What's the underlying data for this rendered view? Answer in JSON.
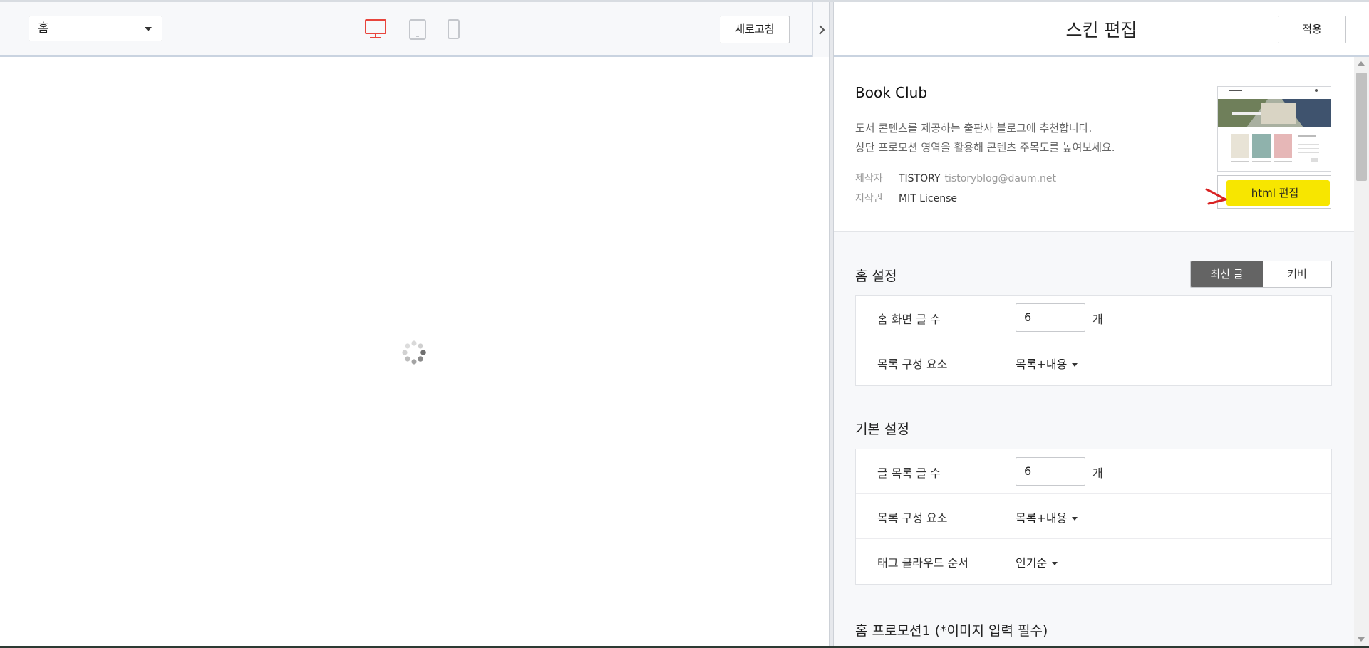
{
  "toolbar": {
    "page_select_value": "홈",
    "refresh_label": "새로고침",
    "devices": [
      "desktop-icon",
      "tablet-icon",
      "mobile-icon"
    ],
    "active_device": "desktop",
    "accent_color": "#e8453c"
  },
  "editor": {
    "title": "스킨 편집",
    "apply_label": "적용",
    "skin": {
      "name": "Book Club",
      "description_line1": "도서 콘텐츠를 제공하는 출판사 블로그에 추천합니다.",
      "description_line2": "상단 프로모션 영역을 활용해 콘텐츠 주목도를 높여보세요.",
      "author_key": "제작자",
      "author_name": "TISTORY",
      "author_email": "tistoryblog@daum.net",
      "license_key": "저작권",
      "license_value": "MIT License",
      "html_edit_label": "html 편집",
      "highlight_color": "#f7e600"
    },
    "home_settings": {
      "title": "홈 설정",
      "tabs": [
        "최신 글",
        "커버"
      ],
      "active_tab": "최신 글",
      "rows": [
        {
          "label": "홈 화면 글 수",
          "value": "6",
          "unit": "개"
        },
        {
          "label": "목록 구성 요소",
          "value": "목록+내용"
        }
      ]
    },
    "basic_settings": {
      "title": "기본 설정",
      "rows": [
        {
          "label": "글 목록 글 수",
          "value": "6",
          "unit": "개"
        },
        {
          "label": "목록 구성 요소",
          "value": "목록+내용"
        },
        {
          "label": "태그 클라우드 순서",
          "value": "인기순"
        }
      ]
    },
    "promotion_title": "홈 프로모션1 (*이미지 입력 필수)"
  }
}
